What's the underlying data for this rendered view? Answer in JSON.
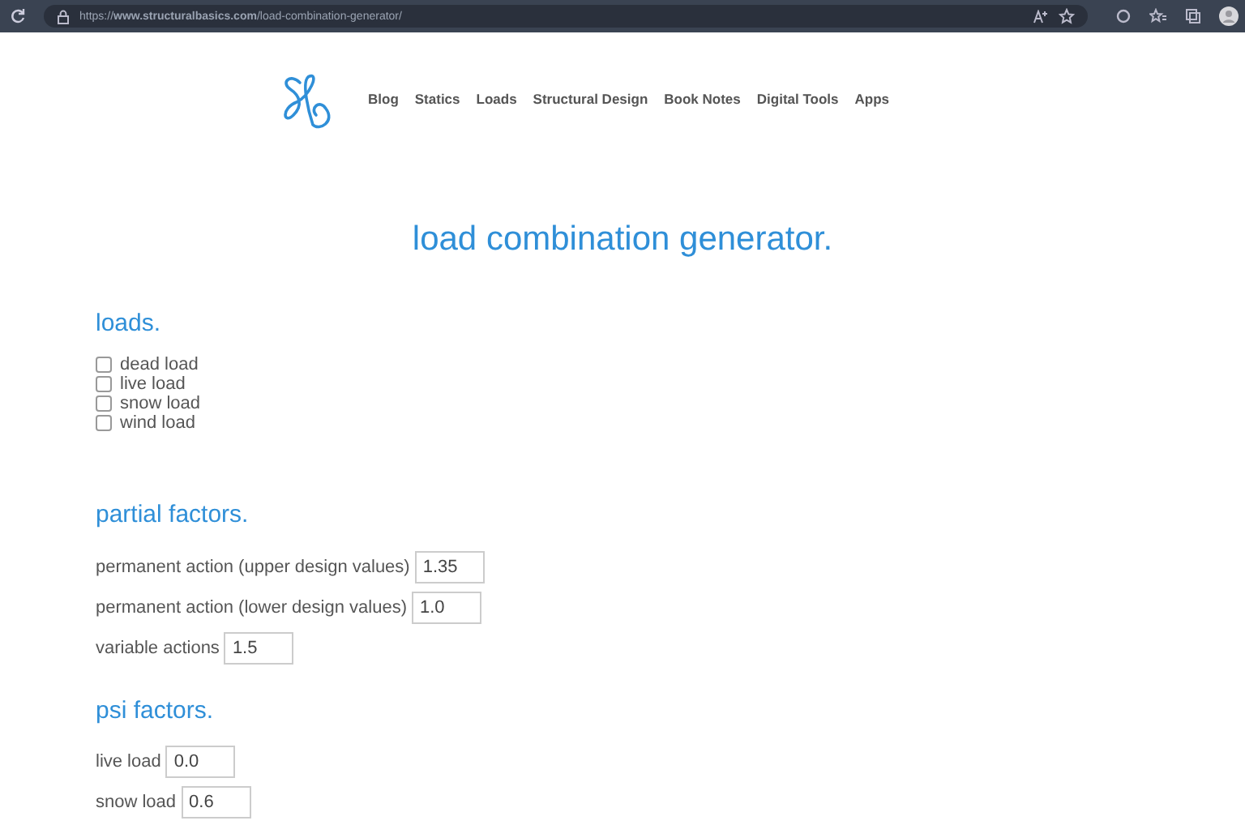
{
  "browser": {
    "url": "https://**www.structuralbasics.com**/load-combination-generator/"
  },
  "nav": [
    "Blog",
    "Statics",
    "Loads",
    "Structural Design",
    "Book Notes",
    "Digital Tools",
    "Apps"
  ],
  "title": "load combination generator.",
  "loads": {
    "heading": "loads.",
    "items": [
      {
        "label": "dead load",
        "checked": false
      },
      {
        "label": "live load",
        "checked": false
      },
      {
        "label": "snow load",
        "checked": false
      },
      {
        "label": "wind load",
        "checked": false
      }
    ]
  },
  "partial_factors": {
    "heading": "partial factors.",
    "fields": [
      {
        "label": "permanent action (upper design values)",
        "value": "1.35"
      },
      {
        "label": "permanent action (lower design values)",
        "value": "1.0"
      },
      {
        "label": "variable actions",
        "value": "1.5"
      }
    ]
  },
  "psi_factors": {
    "heading": "psi factors.",
    "fields": [
      {
        "label": "live load",
        "value": "0.0"
      },
      {
        "label": "snow load",
        "value": "0.6"
      }
    ]
  }
}
